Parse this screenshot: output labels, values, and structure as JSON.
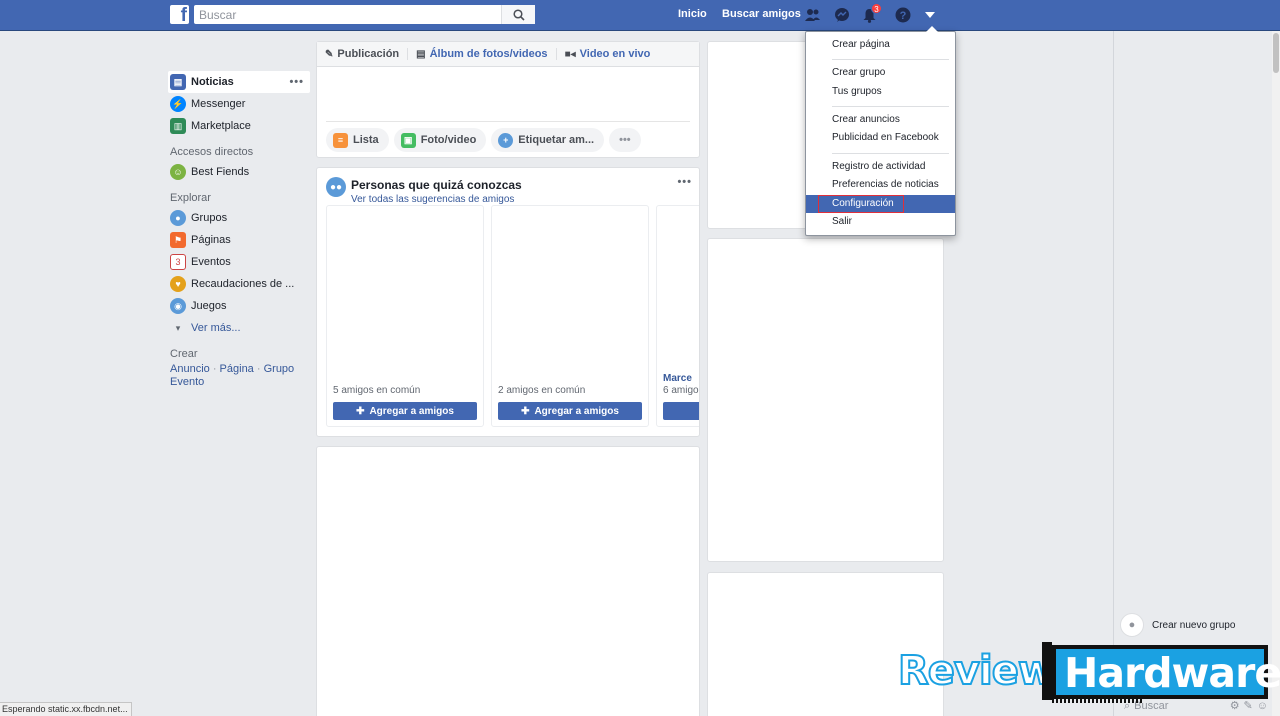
{
  "topbar": {
    "search_placeholder": "Buscar",
    "nav": [
      "Inicio",
      "Buscar amigos"
    ],
    "notif_count": "3"
  },
  "sidebar": {
    "items": [
      {
        "label": "Noticias",
        "icon": "news-feed-icon"
      },
      {
        "label": "Messenger",
        "icon": "messenger-icon"
      },
      {
        "label": "Marketplace",
        "icon": "marketplace-icon"
      }
    ],
    "shortcuts_header": "Accesos directos",
    "shortcuts": [
      {
        "label": "Best Fiends",
        "icon": "game-icon"
      }
    ],
    "explore_header": "Explorar",
    "explore": [
      {
        "label": "Grupos",
        "icon": "groups-icon"
      },
      {
        "label": "Páginas",
        "icon": "flag-icon"
      },
      {
        "label": "Eventos",
        "icon": "calendar-icon"
      },
      {
        "label": "Recaudaciones de ...",
        "icon": "fundraiser-icon"
      },
      {
        "label": "Juegos",
        "icon": "gamepad-icon"
      }
    ],
    "see_more": "Ver más...",
    "create_header": "Crear",
    "create_links": [
      "Anuncio",
      "Página",
      "Grupo",
      "Evento"
    ]
  },
  "composer": {
    "tabs": [
      "Publicación",
      "Álbum de fotos/videos",
      "Video en vivo"
    ],
    "actions": [
      "Lista",
      "Foto/video",
      "Etiquetar am..."
    ]
  },
  "pymk": {
    "title": "Personas que quizá conozcas",
    "subtitle": "Ver todas las sugerencias de amigos",
    "cards": [
      {
        "name": "",
        "common": "5 amigos en común",
        "button": "Agregar a amigos"
      },
      {
        "name": "",
        "common": "2 amigos en común",
        "button": "Agregar a amigos"
      },
      {
        "name": "Marce",
        "common": "6 amigo",
        "button": ""
      }
    ]
  },
  "dropdown": {
    "groups": [
      [
        "Crear página"
      ],
      [
        "Crear grupo",
        "Tus grupos"
      ],
      [
        "Crear anuncios",
        "Publicidad en Facebook"
      ],
      [
        "Registro de actividad",
        "Preferencias de noticias",
        "Configuración",
        "Salir"
      ]
    ],
    "selected": "Configuración"
  },
  "chat": {
    "new_group": "Crear nuevo grupo",
    "search_placeholder": "Buscar"
  },
  "status": "Esperando static.xx.fbcdn.net...",
  "watermark": {
    "left": "Review",
    "right": "Hardware"
  },
  "colors": {
    "brand": "#4267b2",
    "link": "#365899",
    "badge": "#fa3e3e",
    "highlight": "#e02f3b"
  }
}
